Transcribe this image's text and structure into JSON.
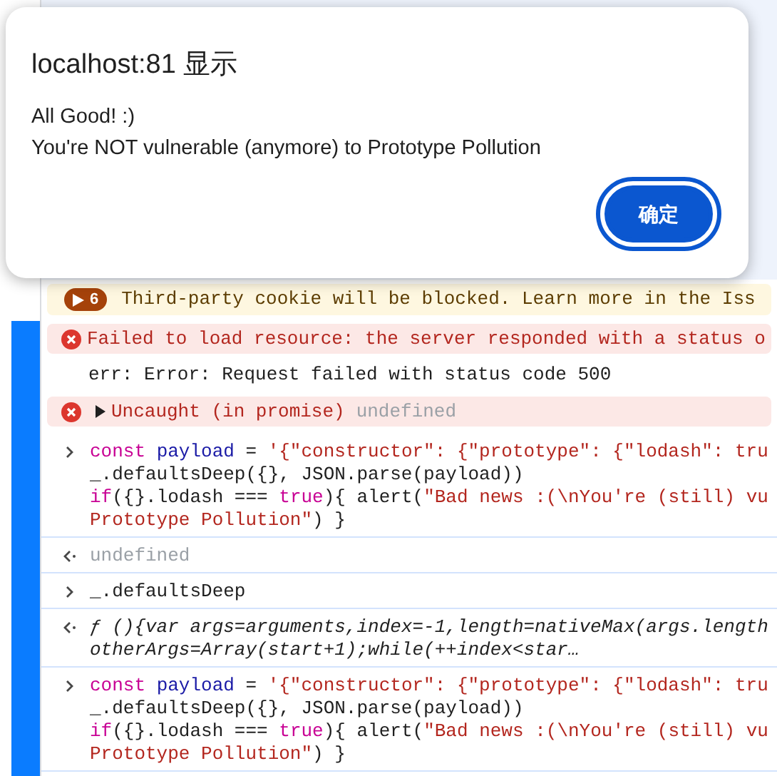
{
  "dialog": {
    "title": "localhost:81 显示",
    "message": [
      "All Good! :)",
      "You're NOT vulnerable (anymore) to Prototype Pollution"
    ],
    "button": "确定"
  },
  "console": [
    {
      "kind": "warning",
      "badge": "6",
      "text": "Third-party cookie will be blocked. Learn more in the Iss"
    },
    {
      "kind": "error",
      "text": "Failed to load resource: the server responded with a status o"
    },
    {
      "kind": "log",
      "text": "err: Error: Request failed with status code 500"
    },
    {
      "kind": "error",
      "expandable": true,
      "text": "Uncaught (in promise)",
      "detail": "undefined"
    },
    {
      "kind": "input",
      "lines": [
        [
          {
            "t": "const ",
            "color": "#c80094"
          },
          {
            "t": "payload",
            "color": "#1a1aa6"
          },
          {
            "t": " = ",
            "color": "#1f1f1f"
          },
          {
            "t": "'{\"constructor\": {\"prototype\": {\"lodash\": tru",
            "color": "#b3261e"
          }
        ],
        [
          {
            "t": "_.defaultsDeep({}, JSON.parse(payload))",
            "color": "#1f1f1f"
          }
        ],
        [
          {
            "t": "if",
            "color": "#c80094"
          },
          {
            "t": "({}.lodash === ",
            "color": "#1f1f1f"
          },
          {
            "t": "true",
            "color": "#c80094"
          },
          {
            "t": "){ alert(",
            "color": "#1f1f1f"
          },
          {
            "t": "\"Bad news :(\\nYou're (still) vu",
            "color": "#b3261e"
          }
        ],
        [
          {
            "t": "Prototype Pollution\"",
            "color": "#b3261e"
          },
          {
            "t": ") }",
            "color": "#1f1f1f"
          }
        ]
      ]
    },
    {
      "kind": "result",
      "italic": false,
      "lines": [
        "undefined"
      ],
      "dim": true
    },
    {
      "kind": "input",
      "lines": [
        [
          {
            "t": "_.defaultsDeep",
            "color": "#1f1f1f"
          }
        ]
      ]
    },
    {
      "kind": "result",
      "italic": true,
      "dim": false,
      "lines": [
        "ƒ (){var args=arguments,index=-1,length=nativeMax(args.length",
        "otherArgs=Array(start+1);while(++index<star…"
      ]
    },
    {
      "kind": "input",
      "lines": [
        [
          {
            "t": "const ",
            "color": "#c80094"
          },
          {
            "t": "payload",
            "color": "#1a1aa6"
          },
          {
            "t": " = ",
            "color": "#1f1f1f"
          },
          {
            "t": "'{\"constructor\": {\"prototype\": {\"lodash\": tru",
            "color": "#b3261e"
          }
        ],
        [
          {
            "t": "_.defaultsDeep({}, JSON.parse(payload))",
            "color": "#1f1f1f"
          }
        ],
        [
          {
            "t": "if",
            "color": "#c80094"
          },
          {
            "t": "({}.lodash === ",
            "color": "#1f1f1f"
          },
          {
            "t": "true",
            "color": "#c80094"
          },
          {
            "t": "){ alert(",
            "color": "#1f1f1f"
          },
          {
            "t": "\"Bad news :(\\nYou're (still) vu",
            "color": "#b3261e"
          }
        ],
        [
          {
            "t": "Prototype Pollution\"",
            "color": "#b3261e"
          },
          {
            "t": ") }",
            "color": "#1f1f1f"
          }
        ]
      ]
    }
  ]
}
